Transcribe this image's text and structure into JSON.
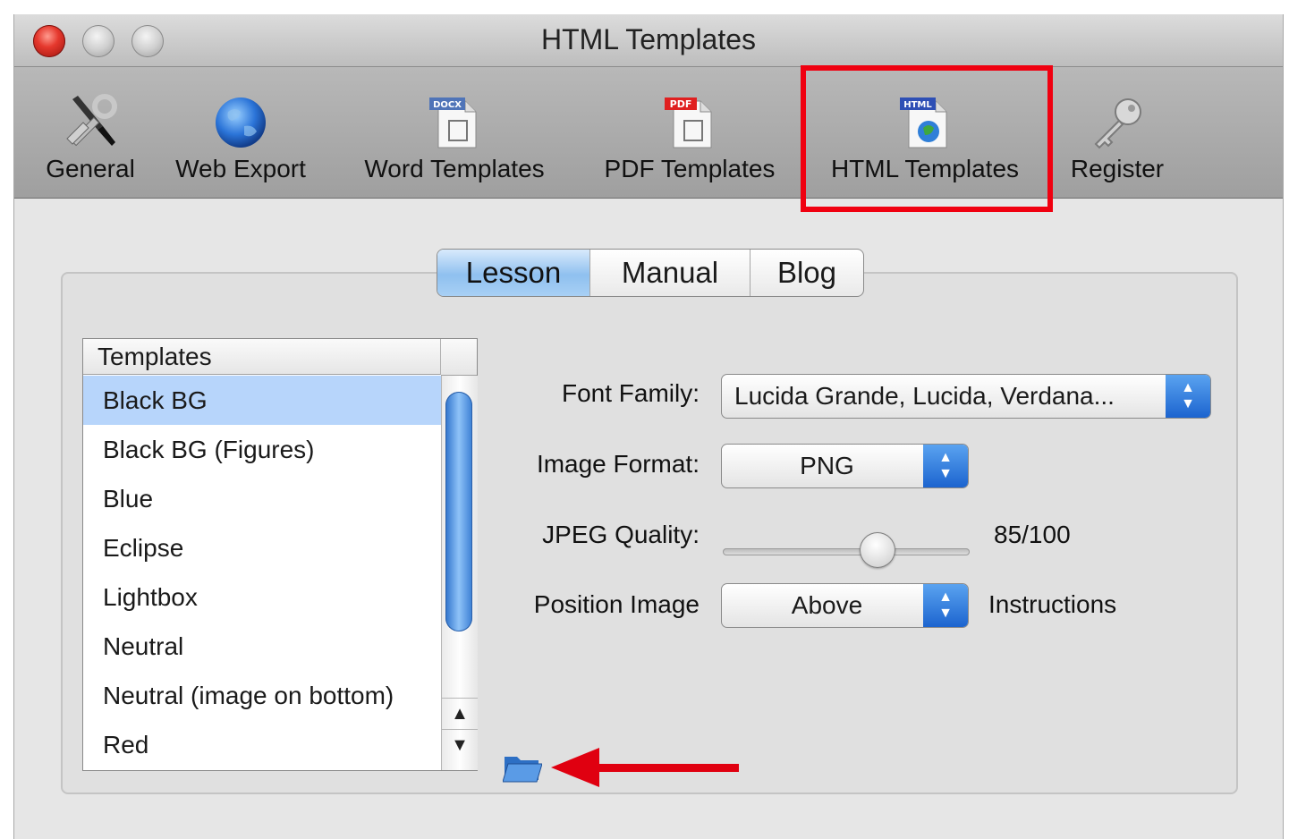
{
  "window": {
    "title": "HTML Templates"
  },
  "toolbar": {
    "items": [
      {
        "label": "General",
        "icon": "tools-icon"
      },
      {
        "label": "Web Export",
        "icon": "globe-icon"
      },
      {
        "label": "Word Templates",
        "icon": "docx-icon",
        "badge": "DOCX"
      },
      {
        "label": "PDF Templates",
        "icon": "pdf-icon",
        "badge": "PDF"
      },
      {
        "label": "HTML Templates",
        "icon": "html-icon",
        "badge": "HTML",
        "selected": true
      },
      {
        "label": "Register",
        "icon": "key-icon"
      }
    ]
  },
  "tabs": [
    {
      "label": "Lesson",
      "active": true
    },
    {
      "label": "Manual"
    },
    {
      "label": "Blog"
    }
  ],
  "templates": {
    "header": "Templates",
    "items": [
      "Black BG",
      "Black BG (Figures)",
      "Blue",
      "Eclipse",
      "Lightbox",
      "Neutral",
      "Neutral (image on bottom)",
      "Red"
    ],
    "selected_index": 0
  },
  "form": {
    "font_family": {
      "label": "Font Family:",
      "value": "Lucida Grande, Lucida, Verdana..."
    },
    "image_format": {
      "label": "Image Format:",
      "value": "PNG"
    },
    "jpeg_quality": {
      "label": "JPEG Quality:",
      "value": "85/100",
      "fraction": 0.65
    },
    "position_image": {
      "label": "Position Image",
      "value": "Above",
      "suffix": "Instructions"
    }
  },
  "colors": {
    "highlight": "#f00010",
    "selection": "#b7d5fb",
    "accent": "#1c64cf"
  }
}
